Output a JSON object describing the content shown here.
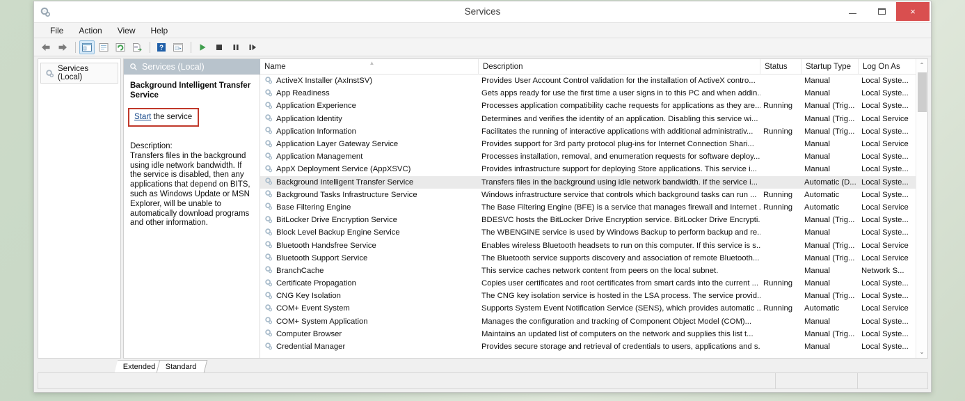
{
  "window": {
    "title": "Services",
    "icon": "services-gear-icon",
    "minimize_label": "Minimize",
    "maximize_label": "Maximize",
    "close_label": "×"
  },
  "menubar": {
    "items": [
      {
        "label": "File",
        "name": "menu-file"
      },
      {
        "label": "Action",
        "name": "menu-action"
      },
      {
        "label": "View",
        "name": "menu-view"
      },
      {
        "label": "Help",
        "name": "menu-help"
      }
    ]
  },
  "toolbar": {
    "buttons": [
      {
        "name": "back-icon",
        "glyph": "⬅"
      },
      {
        "name": "forward-icon",
        "glyph": "➡"
      },
      {
        "name": "show-hide-console-tree-icon",
        "glyph": "▤"
      },
      {
        "name": "properties-icon",
        "glyph": "▤"
      },
      {
        "name": "refresh-icon",
        "glyph": "↻"
      },
      {
        "name": "export-list-icon",
        "glyph": "▥"
      },
      {
        "name": "help-icon",
        "glyph": "?"
      },
      {
        "name": "show-action-pane-icon",
        "glyph": "▦"
      },
      {
        "name": "start-service-icon",
        "glyph": "▶"
      },
      {
        "name": "stop-service-icon",
        "glyph": "■"
      },
      {
        "name": "pause-service-icon",
        "glyph": "‖"
      },
      {
        "name": "restart-service-icon",
        "glyph": "▷"
      }
    ]
  },
  "tree": {
    "root_label": "Services (Local)",
    "root_icon": "services-gear-icon"
  },
  "details": {
    "header": "Services (Local)",
    "header_icon": "magnifier-icon",
    "service_title": "Background Intelligent Transfer Service",
    "action_link": "Start",
    "action_suffix": " the service",
    "description_label": "Description:",
    "description_text": "Transfers files in the background using idle network bandwidth. If the service is disabled, then any applications that depend on BITS, such as Windows Update or MSN Explorer, will be unable to automatically download programs and other information.",
    "highlight_color": "#c0392b"
  },
  "list": {
    "columns": [
      {
        "label": "Name",
        "name": "column-header-name",
        "sorted": true
      },
      {
        "label": "Description",
        "name": "column-header-description",
        "sorted": false
      },
      {
        "label": "Status",
        "name": "column-header-status",
        "sorted": false
      },
      {
        "label": "Startup Type",
        "name": "column-header-startup-type",
        "sorted": false
      },
      {
        "label": "Log On As",
        "name": "column-header-log-on-as",
        "sorted": false
      }
    ],
    "selected_index": 8,
    "rows": [
      {
        "name": "ActiveX Installer (AxInstSV)",
        "description": "Provides User Account Control validation for the installation of ActiveX contro...",
        "status": "",
        "startup": "Manual",
        "logon": "Local Syste..."
      },
      {
        "name": "App Readiness",
        "description": "Gets apps ready for use the first time a user signs in to this PC and when addin...",
        "status": "",
        "startup": "Manual",
        "logon": "Local Syste..."
      },
      {
        "name": "Application Experience",
        "description": "Processes application compatibility cache requests for applications as they are...",
        "status": "Running",
        "startup": "Manual (Trig...",
        "logon": "Local Syste..."
      },
      {
        "name": "Application Identity",
        "description": "Determines and verifies the identity of an application. Disabling this service wi...",
        "status": "",
        "startup": "Manual (Trig...",
        "logon": "Local Service"
      },
      {
        "name": "Application Information",
        "description": "Facilitates the running of interactive applications with additional administrativ...",
        "status": "Running",
        "startup": "Manual (Trig...",
        "logon": "Local Syste..."
      },
      {
        "name": "Application Layer Gateway Service",
        "description": "Provides support for 3rd party protocol plug-ins for Internet Connection Shari...",
        "status": "",
        "startup": "Manual",
        "logon": "Local Service"
      },
      {
        "name": "Application Management",
        "description": "Processes installation, removal, and enumeration requests for software deploy...",
        "status": "",
        "startup": "Manual",
        "logon": "Local Syste..."
      },
      {
        "name": "AppX Deployment Service (AppXSVC)",
        "description": "Provides infrastructure support for deploying Store applications. This service i...",
        "status": "",
        "startup": "Manual",
        "logon": "Local Syste..."
      },
      {
        "name": "Background Intelligent Transfer Service",
        "description": "Transfers files in the background using idle network bandwidth. If the service i...",
        "status": "",
        "startup": "Automatic (D...",
        "logon": "Local Syste..."
      },
      {
        "name": "Background Tasks Infrastructure Service",
        "description": "Windows infrastructure service that controls which background tasks can run ...",
        "status": "Running",
        "startup": "Automatic",
        "logon": "Local Syste..."
      },
      {
        "name": "Base Filtering Engine",
        "description": "The Base Filtering Engine (BFE) is a service that manages firewall and Internet ...",
        "status": "Running",
        "startup": "Automatic",
        "logon": "Local Service"
      },
      {
        "name": "BitLocker Drive Encryption Service",
        "description": "BDESVC hosts the BitLocker Drive Encryption service. BitLocker Drive Encrypti...",
        "status": "",
        "startup": "Manual (Trig...",
        "logon": "Local Syste..."
      },
      {
        "name": "Block Level Backup Engine Service",
        "description": "The WBENGINE service is used by Windows Backup to perform backup and re...",
        "status": "",
        "startup": "Manual",
        "logon": "Local Syste..."
      },
      {
        "name": "Bluetooth Handsfree Service",
        "description": "Enables wireless Bluetooth headsets to run on this computer. If this service is s...",
        "status": "",
        "startup": "Manual (Trig...",
        "logon": "Local Service"
      },
      {
        "name": "Bluetooth Support Service",
        "description": "The Bluetooth service supports discovery and association of remote Bluetooth...",
        "status": "",
        "startup": "Manual (Trig...",
        "logon": "Local Service"
      },
      {
        "name": "BranchCache",
        "description": "This service caches network content from peers on the local subnet.",
        "status": "",
        "startup": "Manual",
        "logon": "Network S..."
      },
      {
        "name": "Certificate Propagation",
        "description": "Copies user certificates and root certificates from smart cards into the current ...",
        "status": "Running",
        "startup": "Manual",
        "logon": "Local Syste..."
      },
      {
        "name": "CNG Key Isolation",
        "description": "The CNG key isolation service is hosted in the LSA process. The service provid...",
        "status": "",
        "startup": "Manual (Trig...",
        "logon": "Local Syste..."
      },
      {
        "name": "COM+ Event System",
        "description": "Supports System Event Notification Service (SENS), which provides automatic ...",
        "status": "Running",
        "startup": "Automatic",
        "logon": "Local Service"
      },
      {
        "name": "COM+ System Application",
        "description": "Manages the configuration and tracking of Component Object Model (COM)...",
        "status": "",
        "startup": "Manual",
        "logon": "Local Syste..."
      },
      {
        "name": "Computer Browser",
        "description": "Maintains an updated list of computers on the network and supplies this list t...",
        "status": "",
        "startup": "Manual (Trig...",
        "logon": "Local Syste..."
      },
      {
        "name": "Credential Manager",
        "description": "Provides secure storage and retrieval of credentials to users, applications and s...",
        "status": "",
        "startup": "Manual",
        "logon": "Local Syste..."
      }
    ]
  },
  "tabs": {
    "items": [
      {
        "label": "Extended",
        "name": "tab-extended",
        "selected": false
      },
      {
        "label": "Standard",
        "name": "tab-standard",
        "selected": true
      }
    ]
  },
  "statusbar": {
    "main": "",
    "pane2": "",
    "pane3": ""
  },
  "scrollbar": {
    "up_glyph": "⌃",
    "down_glyph": "⌄"
  }
}
